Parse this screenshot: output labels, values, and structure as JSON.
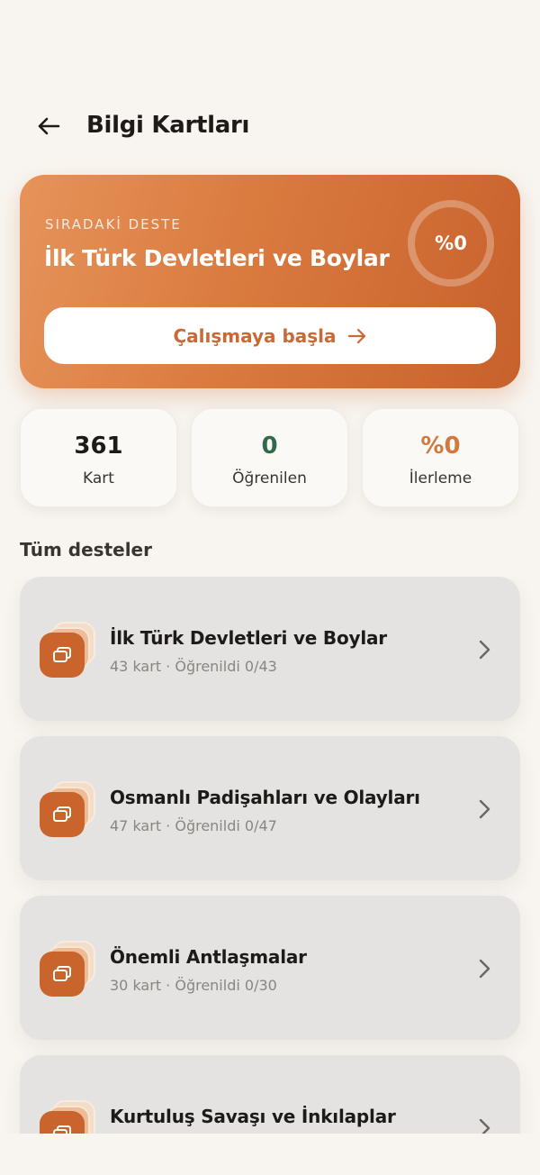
{
  "header": {
    "title": "Bilgi Kartları"
  },
  "hero": {
    "eyebrow": "SIRADAKİ DESTE",
    "title": "İlk Türk Devletleri ve Boylar",
    "progress_label": "%0",
    "progress": 0,
    "cta_label": "Çalışmaya başla"
  },
  "stats": [
    {
      "value": "361",
      "label": "Kart",
      "color": "#1e1a17"
    },
    {
      "value": "0",
      "label": "Öğrenilen",
      "color": "#2f6b4a"
    },
    {
      "value": "%0",
      "label": "İlerleme",
      "color": "#d07a3e"
    }
  ],
  "section_title": "Tüm desteler",
  "decks": [
    {
      "title": "İlk Türk Devletleri ve Boylar",
      "meta": "43 kart · Öğrenildi 0/43"
    },
    {
      "title": "Osmanlı Padişahları ve Olayları",
      "meta": "47 kart · Öğrenildi 0/47"
    },
    {
      "title": "Önemli Antlaşmalar",
      "meta": "30 kart · Öğrenildi 0/30"
    },
    {
      "title": "Kurtuluş Savaşı ve İnkılaplar",
      "meta": ""
    }
  ],
  "icons": {
    "back": "arrow-left-icon",
    "cta": "arrow-right-icon",
    "deck": "cards-stack-icon",
    "chevron": "chevron-right-icon"
  },
  "colors": {
    "accent": "#c9642d",
    "accent_light": "#e6935a",
    "background": "#f8f5f0",
    "learned": "#2f6b4a"
  }
}
